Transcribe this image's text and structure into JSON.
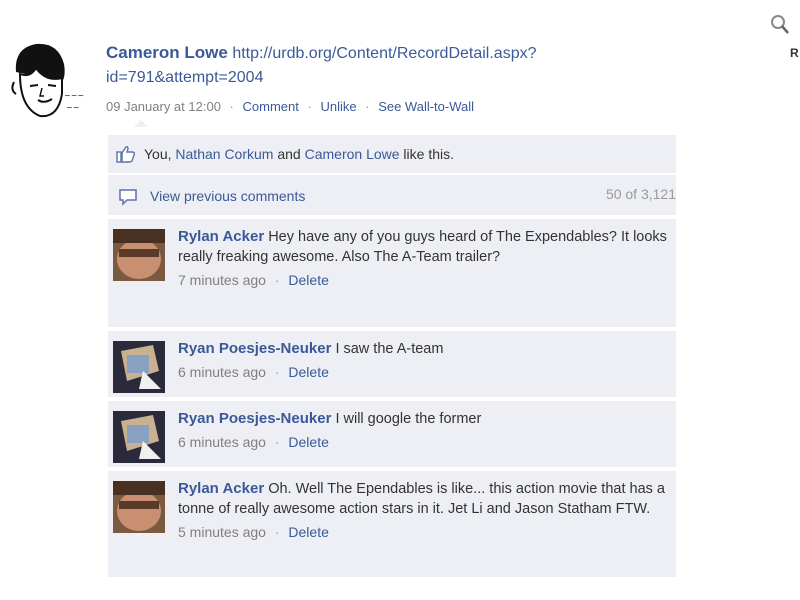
{
  "post": {
    "author": "Cameron Lowe",
    "url_text": "http://urdb.org/Content/RecordDetail.aspx?id=791&attempt=2004",
    "timestamp": "09 January at 12:00",
    "actions": {
      "comment": "Comment",
      "unlike": "Unlike",
      "wall_to_wall": "See Wall-to-Wall"
    },
    "separator": "·"
  },
  "search": {
    "partial_label": "R"
  },
  "likes": {
    "you": "You,",
    "liker_1": "Nathan Corkum",
    "conj": "and",
    "liker_2": "Cameron Lowe",
    "suffix": "like this."
  },
  "comments_header": {
    "view_previous": "View previous comments",
    "count": "50 of 3,121"
  },
  "comments": [
    {
      "name": "Rylan Acker",
      "text": "Hey have any of you guys heard of The Expendables? It looks really freaking awesome. Also The A-Team trailer?",
      "time": "7 minutes ago",
      "delete": "Delete"
    },
    {
      "name": "Ryan Poesjes-Neuker",
      "text": "I saw the A-team",
      "time": "6 minutes ago",
      "delete": "Delete"
    },
    {
      "name": "Ryan Poesjes-Neuker",
      "text": "I will google the former",
      "time": "6 minutes ago",
      "delete": "Delete"
    },
    {
      "name": "Rylan Acker",
      "text": "Oh. Well The Ependables is like... this action movie that has a tonne of really awesome action stars in it. Jet Li and Jason Statham FTW.",
      "time": "5 minutes ago",
      "delete": "Delete"
    }
  ],
  "icons": {
    "search": "search-icon",
    "like": "thumbs-up-icon",
    "comments": "speech-bubble-icon"
  },
  "colors": {
    "link": "#3b5998",
    "panel": "#edeff4",
    "meta": "#808080"
  }
}
